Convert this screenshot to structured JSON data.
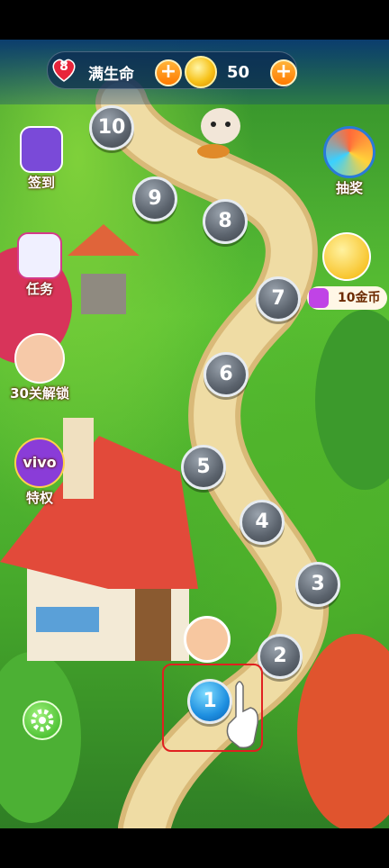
{
  "hud": {
    "lives_count": "8",
    "lives_label": "满生命",
    "coins": "50",
    "plus_symbol": "+"
  },
  "side_left": [
    {
      "label": "签到",
      "icon": "calendar-icon"
    },
    {
      "label": "任务",
      "icon": "task-list-icon"
    },
    {
      "label": "30关解锁",
      "icon": "character-portrait-icon"
    },
    {
      "label": "特权",
      "badge": "vivo",
      "icon": "crown-icon"
    }
  ],
  "side_right": [
    {
      "label": "抽奖",
      "icon": "lucky-wheel-icon"
    },
    {
      "label": "10金币",
      "icon": "star-coin-icon"
    }
  ],
  "levels": [
    {
      "num": "10"
    },
    {
      "num": "9"
    },
    {
      "num": "8"
    },
    {
      "num": "7"
    },
    {
      "num": "6"
    },
    {
      "num": "5"
    },
    {
      "num": "4"
    },
    {
      "num": "3"
    },
    {
      "num": "2"
    },
    {
      "num": "1"
    }
  ],
  "colors": {
    "accent": "#ff7a00",
    "current_level": "#1e8fe0",
    "highlight": "#e02020"
  }
}
